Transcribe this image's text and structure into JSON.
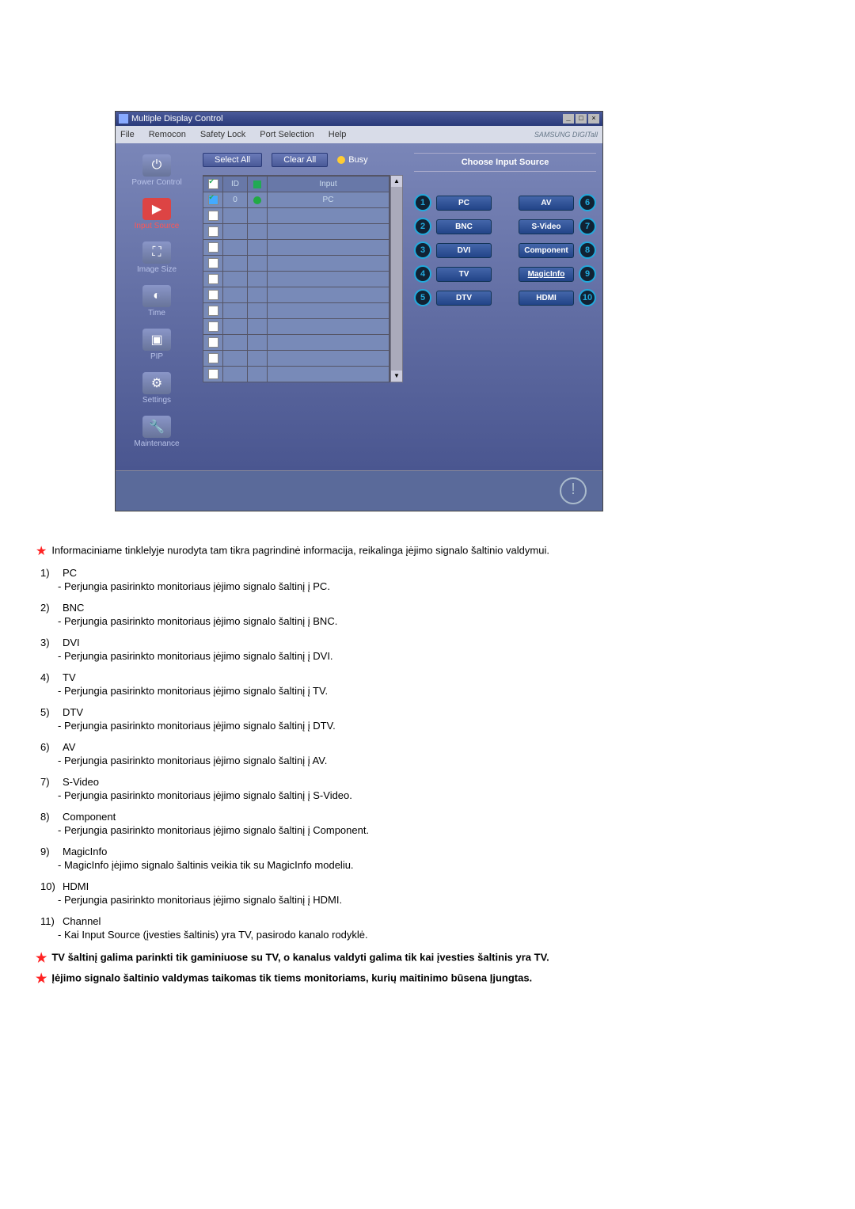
{
  "window": {
    "title": "Multiple Display Control",
    "minimize": "_",
    "maximize": "□",
    "close": "×"
  },
  "menu": {
    "file": "File",
    "remocon": "Remocon",
    "safety": "Safety Lock",
    "port": "Port Selection",
    "help": "Help",
    "brand": "SAMSUNG DIGITall"
  },
  "sidebar": {
    "power": "Power Control",
    "input": "Input Source",
    "image": "Image Size",
    "time": "Time",
    "pip": "PIP",
    "settings": "Settings",
    "maint": "Maintenance"
  },
  "buttons": {
    "selectall": "Select All",
    "clearall": "Clear All",
    "busy": "Busy"
  },
  "gridhead": {
    "id": "ID",
    "input": "Input"
  },
  "row0": {
    "id": "0",
    "input": "PC"
  },
  "panel": {
    "title": "Choose Input Source",
    "pc": "PC",
    "av": "AV",
    "bnc": "BNC",
    "svideo": "S-Video",
    "dvi": "DVI",
    "comp": "Component",
    "tv": "TV",
    "magic": "MagicInfo",
    "dtv": "DTV",
    "hdmi": "HDMI",
    "n1": "1",
    "n2": "2",
    "n3": "3",
    "n4": "4",
    "n5": "5",
    "n6": "6",
    "n7": "7",
    "n8": "8",
    "n9": "9",
    "n10": "10"
  },
  "intro": "Informaciniame tinklelyje nurodyta tam tikra pagrindinė informacija, reikalinga įėjimo signalo šaltinio valdymui.",
  "items": {
    "n1": "1)",
    "t1": "PC",
    "d1": "- Perjungia pasirinkto monitoriaus įėjimo signalo šaltinį į PC.",
    "n2": "2)",
    "t2": "BNC",
    "d2": "- Perjungia pasirinkto monitoriaus įėjimo signalo šaltinį į BNC.",
    "n3": "3)",
    "t3": "DVI",
    "d3": "- Perjungia pasirinkto monitoriaus įėjimo signalo šaltinį į DVI.",
    "n4": "4)",
    "t4": "TV",
    "d4": "- Perjungia pasirinkto monitoriaus įėjimo signalo šaltinį į TV.",
    "n5": "5)",
    "t5": "DTV",
    "d5": "- Perjungia pasirinkto monitoriaus įėjimo signalo šaltinį į DTV.",
    "n6": "6)",
    "t6": "AV",
    "d6": "- Perjungia pasirinkto monitoriaus įėjimo signalo šaltinį į AV.",
    "n7": "7)",
    "t7": "S-Video",
    "d7": "- Perjungia pasirinkto monitoriaus įėjimo signalo šaltinį į S-Video.",
    "n8": "8)",
    "t8": "Component",
    "d8": "- Perjungia pasirinkto monitoriaus įėjimo signalo šaltinį į Component.",
    "n9": "9)",
    "t9": "MagicInfo",
    "d9": "- MagicInfo įėjimo signalo šaltinis veikia tik su MagicInfo modeliu.",
    "n10": "10)",
    "t10": "HDMI",
    "d10": "- Perjungia pasirinkto monitoriaus įėjimo signalo šaltinį į HDMI.",
    "n11": "11)",
    "t11": "Channel",
    "d11": "- Kai Input Source (įvesties šaltinis) yra TV, pasirodo kanalo rodyklė."
  },
  "note1": "TV šaltinį galima parinkti tik gaminiuose su TV, o kanalus valdyti galima tik kai įvesties šaltinis yra TV.",
  "note2": "Įėjimo signalo šaltinio valdymas taikomas tik tiems monitoriams, kurių maitinimo būsena Įjungtas."
}
